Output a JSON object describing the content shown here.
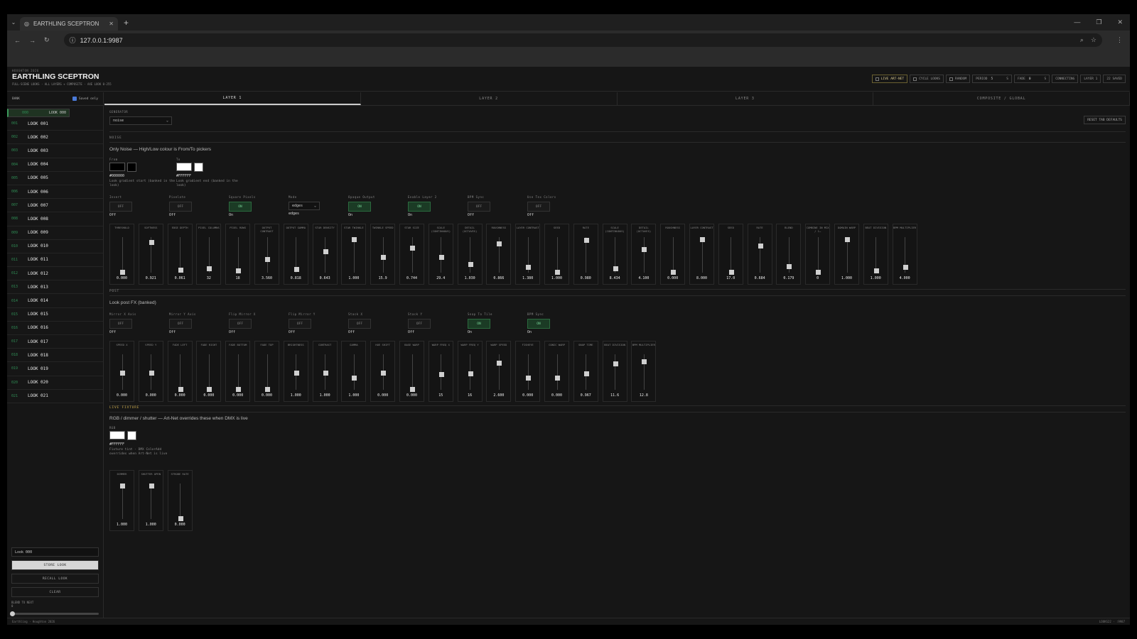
{
  "browser": {
    "tab_title": "EARTHLING SCEPTRON",
    "url": "127.0.0.1:9987"
  },
  "header": {
    "kicker": "HOUGHTON 2026",
    "title": "EARTHLING SCEPTRON",
    "subtitle": "FULL-SCENE LOOKS · ALL LAYERS + COMPOSITE · AXE LOOK 0-255",
    "buttons": {
      "live": "LIVE ART-NET",
      "cycle": "CYCLE LOOKS",
      "random": "RANDOM",
      "period_label": "PERIOD",
      "period_value": "5",
      "period_unit": "S",
      "fade_label": "FADE",
      "fade_value": "0",
      "fade_unit": "S",
      "connecting": "CONNECTING",
      "layer": "LAYER 1",
      "saved": "22 SAVED"
    }
  },
  "sidebar": {
    "title": "BANK",
    "saved_only": "Saved only",
    "looks": [
      {
        "n": "000",
        "name": "LOOK 000"
      },
      {
        "n": "001",
        "name": "LOOK 001"
      },
      {
        "n": "002",
        "name": "LOOK 002"
      },
      {
        "n": "003",
        "name": "LOOK 003"
      },
      {
        "n": "004",
        "name": "LOOK 004"
      },
      {
        "n": "005",
        "name": "LOOK 005"
      },
      {
        "n": "006",
        "name": "LOOK 006"
      },
      {
        "n": "007",
        "name": "LOOK 007"
      },
      {
        "n": "008",
        "name": "LOOK 008"
      },
      {
        "n": "009",
        "name": "LOOK 009"
      },
      {
        "n": "010",
        "name": "LOOK 010"
      },
      {
        "n": "011",
        "name": "LOOK 011"
      },
      {
        "n": "012",
        "name": "LOOK 012"
      },
      {
        "n": "013",
        "name": "LOOK 013"
      },
      {
        "n": "014",
        "name": "LOOK 014"
      },
      {
        "n": "015",
        "name": "LOOK 015"
      },
      {
        "n": "016",
        "name": "LOOK 016"
      },
      {
        "n": "017",
        "name": "LOOK 017"
      },
      {
        "n": "018",
        "name": "LOOK 018"
      },
      {
        "n": "019",
        "name": "LOOK 019"
      },
      {
        "n": "020",
        "name": "LOOK 020"
      },
      {
        "n": "021",
        "name": "LOOK 021"
      }
    ],
    "name_input": "Look 000",
    "store": "STORE LOOK",
    "recall": "RECALL LOOK",
    "clear": "CLEAR",
    "blend_label": "BLEND TO NEXT",
    "blend_value": "0"
  },
  "tabs": [
    "LAYER 1",
    "LAYER 2",
    "LAYER 3",
    "COMPOSITE / GLOBAL"
  ],
  "generator": {
    "label": "GENERATOR",
    "value": "noise",
    "reset": "RESET TAB DEFAULTS"
  },
  "noise": {
    "section": "NOISE",
    "desc": "Only Noise — High/Low colour is From/To pickers",
    "from": {
      "label": "From",
      "hex": "#000000",
      "color": "#000000",
      "desc": "Look gradient start (banked in the look)"
    },
    "to": {
      "label": "To",
      "hex": "#FFFFFF",
      "color": "#FFFFFF",
      "desc": "Look gradient end (banked in the look)"
    },
    "toggles": [
      {
        "label": "Invert",
        "btn": "OFF",
        "state": "Off",
        "on": false
      },
      {
        "label": "Pixelate",
        "btn": "OFF",
        "state": "Off",
        "on": false
      },
      {
        "label": "Square Pixels",
        "btn": "ON",
        "state": "On",
        "on": true
      },
      {
        "label": "Mode",
        "select": "edges",
        "state": "edges"
      },
      {
        "label": "Opaque Output",
        "btn": "ON",
        "state": "On",
        "on": true
      },
      {
        "label": "Enable Layer 2",
        "btn": "ON",
        "state": "On",
        "on": true
      },
      {
        "label": "BPM Sync",
        "btn": "OFF",
        "state": "Off",
        "on": false
      },
      {
        "label": "Use Tex Colors",
        "btn": "OFF",
        "state": "Off",
        "on": false
      }
    ],
    "faders": [
      {
        "label": "THRESHOLD",
        "value": "0.000",
        "pos": 0.0
      },
      {
        "label": "SOFTNESS",
        "value": "0.921",
        "pos": 0.92
      },
      {
        "label": "EDGE DEPTH",
        "value": "0.061",
        "pos": 0.06
      },
      {
        "label": "PIXEL COLUMNS",
        "value": "32",
        "pos": 0.1
      },
      {
        "label": "PIXEL ROWS",
        "value": "18",
        "pos": 0.05
      },
      {
        "label": "OUTPUT CONTRAST",
        "value": "3.560",
        "pos": 0.4
      },
      {
        "label": "OUTPUT GAMMA",
        "value": "0.818",
        "pos": 0.08
      },
      {
        "label": "STAR DENSITY",
        "value": "0.643",
        "pos": 0.64
      },
      {
        "label": "STAR TWINKLE",
        "value": "1.000",
        "pos": 1.0
      },
      {
        "label": "TWINKLE SPEED",
        "value": "15.9",
        "pos": 0.45
      },
      {
        "label": "STAR SIZE",
        "value": "0.744",
        "pos": 0.74
      },
      {
        "label": "SCALE (CONTINUOUS)",
        "value": "29.4",
        "pos": 0.45
      },
      {
        "label": "DETAIL (OCTAVES)",
        "value": "1.030",
        "pos": 0.25
      },
      {
        "label": "ROUGHNESS",
        "value": "0.866",
        "pos": 0.87
      },
      {
        "label": "LAYER CONTRAST",
        "value": "1.380",
        "pos": 0.15
      },
      {
        "label": "SEED",
        "value": "1.000",
        "pos": 0.0
      },
      {
        "label": "RATE",
        "value": "0.980",
        "pos": 0.98
      },
      {
        "label": "SCALE (CONTINUOUS)",
        "value": "8.434",
        "pos": 0.1
      },
      {
        "label": "DETAIL (OCTAVES)",
        "value": "4.100",
        "pos": 0.7
      },
      {
        "label": "ROUGHNESS",
        "value": "0.000",
        "pos": 0.0
      },
      {
        "label": "LAYER CONTRAST",
        "value": "8.000",
        "pos": 1.0
      },
      {
        "label": "SEED",
        "value": "17.0",
        "pos": 0.0
      },
      {
        "label": "RATE",
        "value": "0.684",
        "pos": 0.8
      },
      {
        "label": "BLEND",
        "value": "0.179",
        "pos": 0.18
      },
      {
        "label": "COMBINE IN MIX / 1…",
        "value": "0",
        "pos": 0.0
      },
      {
        "label": "DOMAIN WARP",
        "value": "1.000",
        "pos": 1.0
      },
      {
        "label": "BEAT DIVISION",
        "value": "1.000",
        "pos": 0.05
      },
      {
        "label": "BPM MULTIPLIER",
        "value": "4.000",
        "pos": 0.15
      }
    ]
  },
  "post": {
    "section": "POST",
    "desc": "Look post FX (banked)",
    "toggles": [
      {
        "label": "Mirror X Axis",
        "btn": "OFF",
        "state": "Off",
        "on": false
      },
      {
        "label": "Mirror Y Axis",
        "btn": "OFF",
        "state": "Off",
        "on": false
      },
      {
        "label": "Flip Mirror X",
        "btn": "OFF",
        "state": "Off",
        "on": false
      },
      {
        "label": "Flip Mirror Y",
        "btn": "OFF",
        "state": "Off",
        "on": false
      },
      {
        "label": "Stack X",
        "btn": "OFF",
        "state": "Off",
        "on": false
      },
      {
        "label": "Stack Y",
        "btn": "OFF",
        "state": "Off",
        "on": false
      },
      {
        "label": "Snap To Tile",
        "btn": "ON",
        "state": "On",
        "on": true
      },
      {
        "label": "BPM Sync",
        "btn": "ON",
        "state": "On",
        "on": true
      }
    ],
    "faders": [
      {
        "label": "SPEED X",
        "value": "0.000",
        "pos": 0.5
      },
      {
        "label": "SPEED Y",
        "value": "0.000",
        "pos": 0.5
      },
      {
        "label": "FADE LEFT",
        "value": "0.000",
        "pos": 0.0
      },
      {
        "label": "FADE RIGHT",
        "value": "0.000",
        "pos": 0.0
      },
      {
        "label": "FADE BOTTOM",
        "value": "0.000",
        "pos": 0.0
      },
      {
        "label": "FADE TOP",
        "value": "0.000",
        "pos": 0.0
      },
      {
        "label": "BRIGHTNESS",
        "value": "1.000",
        "pos": 0.5
      },
      {
        "label": "CONTRAST",
        "value": "1.000",
        "pos": 0.5
      },
      {
        "label": "GAMMA",
        "value": "1.000",
        "pos": 0.35
      },
      {
        "label": "HUE SHIFT",
        "value": "0.000",
        "pos": 0.5
      },
      {
        "label": "BASE WARP",
        "value": "0.000",
        "pos": 0.0
      },
      {
        "label": "WARP FREQ X",
        "value": "15",
        "pos": 0.45
      },
      {
        "label": "WARP FREQ Y",
        "value": "16",
        "pos": 0.48
      },
      {
        "label": "WARP SPEED",
        "value": "2.600",
        "pos": 0.8
      },
      {
        "label": "FISHEYE",
        "value": "0.000",
        "pos": 0.35
      },
      {
        "label": "CONIC WARP",
        "value": "0.000",
        "pos": 0.35
      },
      {
        "label": "SNAP TIME",
        "value": "0.967",
        "pos": 0.48
      },
      {
        "label": "BEAT DIVISION",
        "value": "11.6",
        "pos": 0.78
      },
      {
        "label": "BPM MULTIPLIER",
        "value": "12.8",
        "pos": 0.85
      }
    ]
  },
  "fixture": {
    "section": "LIVE FIXTURE",
    "desc": "RGB / dimmer / shutter — Art-Net overrides these when DMX is live",
    "rgb": {
      "label": "RGB",
      "hex": "#FFFFFF",
      "color": "#FFFFFF",
      "desc": "Fixture tint · DMX ColorAdd overrides when Art-Net is live"
    },
    "faders": [
      {
        "label": "DIMMER",
        "value": "1.000",
        "pos": 1.0
      },
      {
        "label": "SHUTTER OPEN",
        "value": "1.000",
        "pos": 1.0
      },
      {
        "label": "STROBE RATE",
        "value": "0.000",
        "pos": 0.0
      }
    ]
  },
  "status": {
    "left": "Earthling · Houghton 2026",
    "right": "LOOKS22 · :9987"
  }
}
